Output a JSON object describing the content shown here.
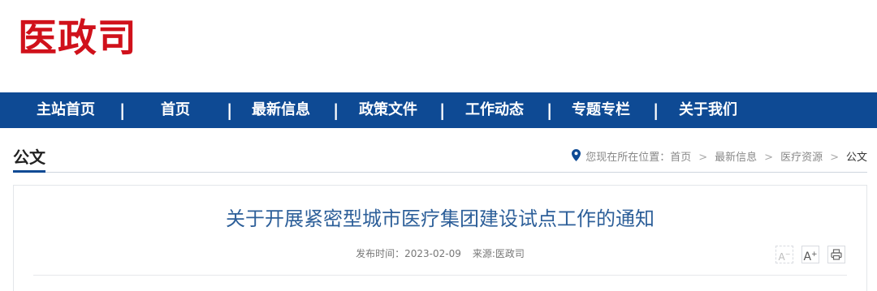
{
  "logo": {
    "text": "医政司"
  },
  "nav": {
    "items": [
      {
        "label": "主站首页"
      },
      {
        "label": "首页"
      },
      {
        "label": "最新信息"
      },
      {
        "label": "政策文件"
      },
      {
        "label": "工作动态"
      },
      {
        "label": "专题专栏"
      },
      {
        "label": "关于我们"
      }
    ],
    "separator": "|"
  },
  "section": {
    "title": "公文",
    "location_label": "您现在所在位置：",
    "breadcrumb": [
      "首页",
      "最新信息",
      "医疗资源",
      "公文"
    ],
    "crumb_sep": ">"
  },
  "article": {
    "title": "关于开展紧密型城市医疗集团建设试点工作的通知",
    "date_label": "发布时间：",
    "date": "2023-02-09",
    "source_label": "来源:",
    "source": "医政司"
  },
  "tools": {
    "font_smaller": "A",
    "font_larger": "A",
    "print_icon": "printer-icon"
  },
  "colors": {
    "brand_red": "#d0111b",
    "nav_blue": "#0e4a94",
    "title_blue": "#2d5f99"
  }
}
